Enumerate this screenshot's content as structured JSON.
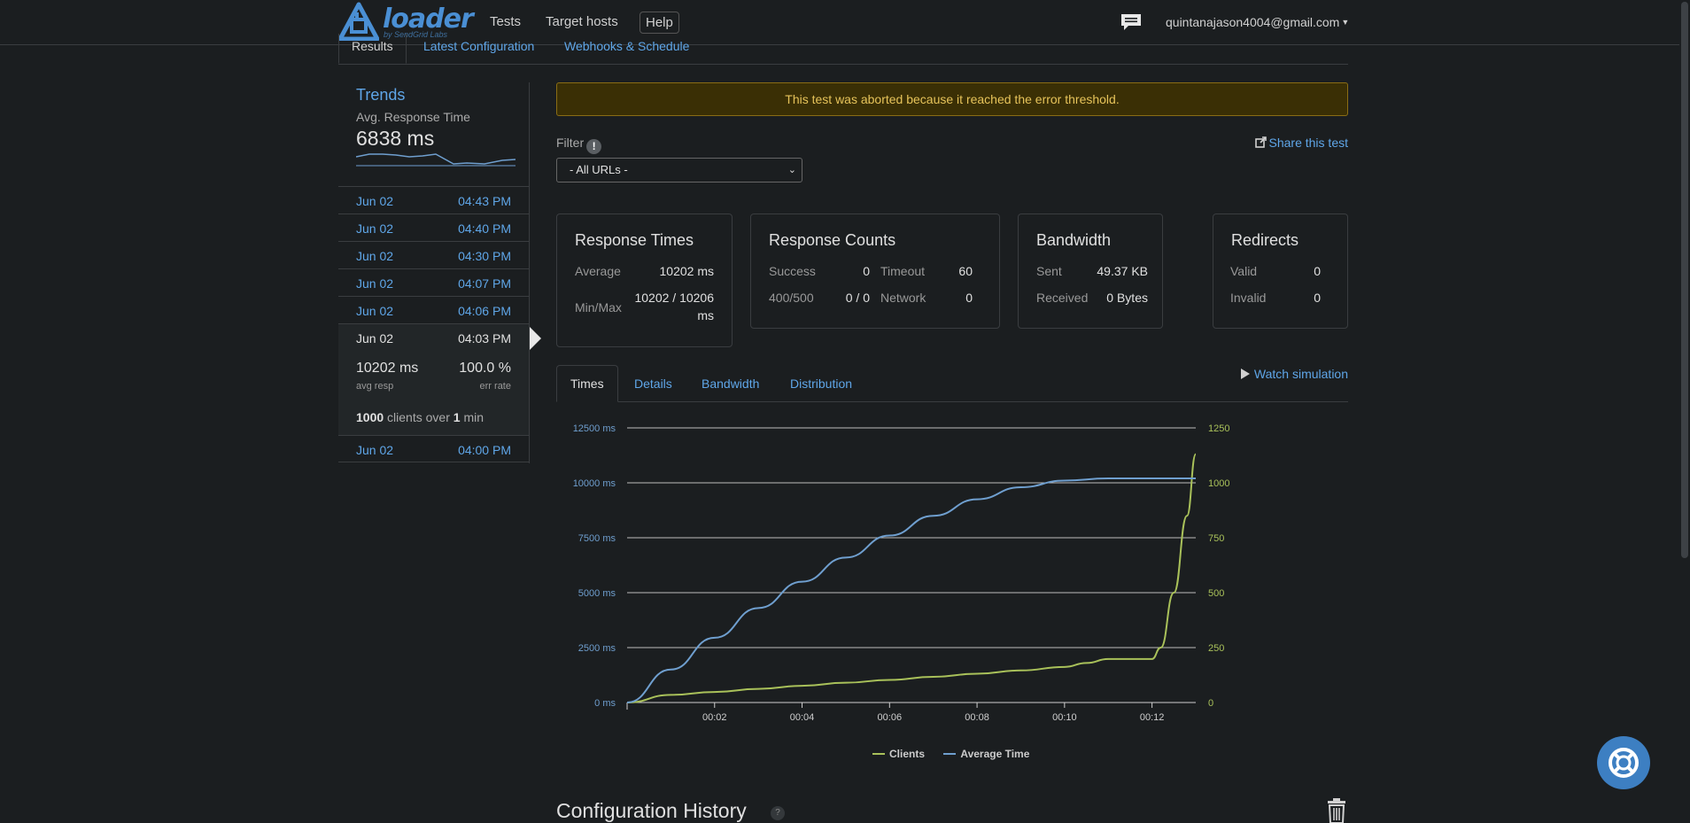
{
  "header": {
    "brand": "loader",
    "brand_sub": "by SendGrid Labs",
    "nav": [
      "Tests",
      "Target hosts",
      "Help"
    ],
    "user_email": "quintanajason4004@gmail.com"
  },
  "tabs": [
    "Results",
    "Latest Configuration",
    "Webhooks & Schedule"
  ],
  "trends": {
    "title": "Trends",
    "subtitle": "Avg. Response Time",
    "value": "6838 ms"
  },
  "runs": [
    {
      "date": "Jun 02",
      "time": "04:43 PM"
    },
    {
      "date": "Jun 02",
      "time": "04:40 PM"
    },
    {
      "date": "Jun 02",
      "time": "04:30 PM"
    },
    {
      "date": "Jun 02",
      "time": "04:07 PM"
    },
    {
      "date": "Jun 02",
      "time": "04:06 PM"
    }
  ],
  "active_run": {
    "date": "Jun 02",
    "time": "04:03 PM",
    "avg_resp": "10202 ms",
    "avg_resp_label": "avg resp",
    "err_rate": "100.0 %",
    "err_rate_label": "err rate",
    "clients": "1000",
    "clients_text": "clients over",
    "duration": "1",
    "duration_unit": "min"
  },
  "last_run": {
    "date": "Jun 02",
    "time": "04:00 PM"
  },
  "alert": "This test was aborted because it reached the error threshold.",
  "filter": {
    "label": "Filter",
    "selected": "- All URLs -"
  },
  "share_label": "Share this test",
  "cards": {
    "response_times": {
      "title": "Response Times",
      "average_label": "Average",
      "average": "10202 ms",
      "minmax_label": "Min/Max",
      "minmax_line1": "10202 / 10206",
      "minmax_line2": "ms"
    },
    "response_counts": {
      "title": "Response Counts",
      "success_label": "Success",
      "success": "0",
      "timeout_label": "Timeout",
      "timeout": "60",
      "status_label": "400/500",
      "status": "0 / 0",
      "network_label": "Network",
      "network": "0"
    },
    "bandwidth": {
      "title": "Bandwidth",
      "sent_label": "Sent",
      "sent": "49.37 KB",
      "received_label": "Received",
      "received": "0 Bytes"
    },
    "redirects": {
      "title": "Redirects",
      "valid_label": "Valid",
      "valid": "0",
      "invalid_label": "Invalid",
      "invalid": "0"
    }
  },
  "chart_tabs": [
    "Times",
    "Details",
    "Bandwidth",
    "Distribution"
  ],
  "watch_label": "Watch simulation",
  "colors": {
    "clients": "#a9c15a",
    "average_time": "#6f9fcf",
    "link": "#5fa6e8"
  },
  "chart_data": {
    "type": "line",
    "x_ticks": [
      "00:02",
      "00:04",
      "00:06",
      "00:08",
      "00:10",
      "00:12"
    ],
    "y_left_ticks": [
      "0 ms",
      "2500 ms",
      "5000 ms",
      "7500 ms",
      "10000 ms",
      "12500 ms"
    ],
    "y_right_ticks": [
      "0",
      "250",
      "500",
      "750",
      "1000",
      "1250"
    ],
    "y_left_lim": [
      0,
      12500
    ],
    "y_right_lim": [
      0,
      1250
    ],
    "x_lim_seconds": [
      0,
      13
    ],
    "grid": true,
    "legend_position": "bottom",
    "series": [
      {
        "name": "Clients",
        "axis": "right",
        "x": [
          0,
          1,
          2,
          3,
          4,
          5,
          6,
          7,
          8,
          9,
          10,
          10.5,
          11,
          11.5,
          12,
          12.2,
          12.5,
          12.8,
          13
        ],
        "values": [
          0,
          35,
          48,
          62,
          76,
          90,
          103,
          117,
          131,
          146,
          162,
          180,
          198,
          198,
          198,
          250,
          500,
          850,
          1130
        ]
      },
      {
        "name": "Average Time",
        "axis": "left",
        "x": [
          0,
          1,
          2,
          3,
          4,
          5,
          6,
          7,
          8,
          9,
          10,
          11,
          12,
          13
        ],
        "values": [
          0,
          1500,
          2950,
          4300,
          5500,
          6600,
          7600,
          8500,
          9250,
          9800,
          10100,
          10200,
          10202,
          10202
        ]
      }
    ]
  }
}
